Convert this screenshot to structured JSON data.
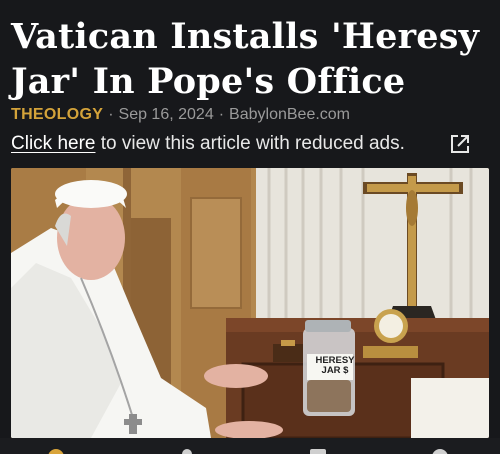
{
  "article": {
    "title": "Vatican Installs 'Heresy Jar' In Pope's Office",
    "category": "THEOLOGY",
    "separator": "·",
    "date": "Sep 16, 2024",
    "source": "BabylonBee.com"
  },
  "ads_notice": {
    "link_text": "Click here",
    "rest_text": " to view this article with reduced ads."
  },
  "image": {
    "jar_label_line1": "HERESY",
    "jar_label_line2": "JAR $"
  },
  "colors": {
    "background": "#17181b",
    "category": "#d4a33a",
    "meta": "#9a9a9a"
  },
  "icons": [
    "external-link-icon"
  ]
}
